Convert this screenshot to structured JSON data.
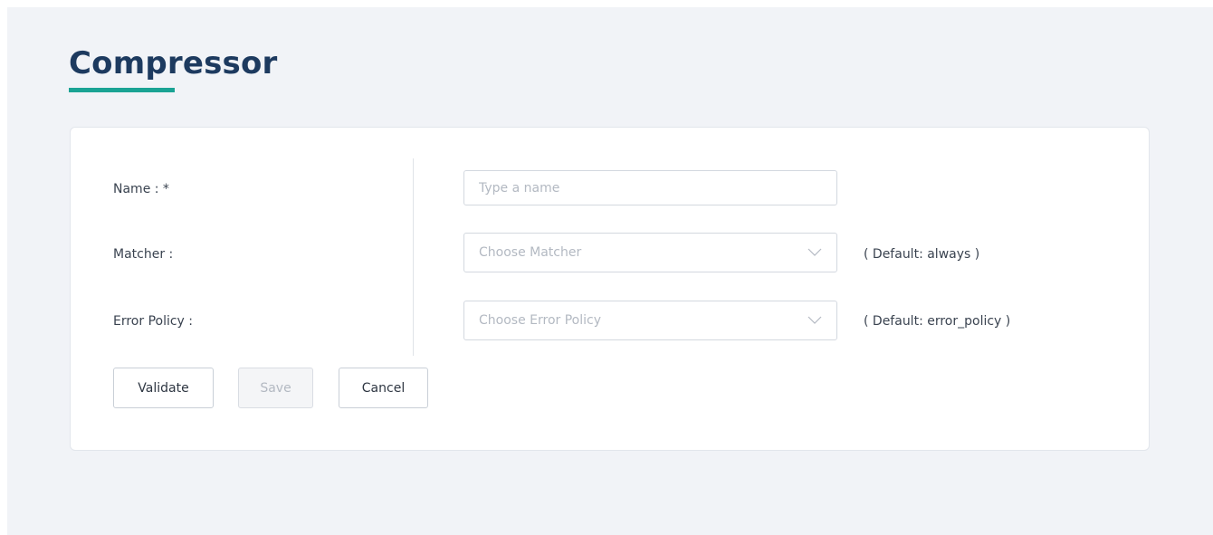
{
  "page": {
    "title": "Compressor"
  },
  "form": {
    "name": {
      "label": "Name : *",
      "placeholder": "Type a name",
      "value": ""
    },
    "matcher": {
      "label": "Matcher :",
      "placeholder": "Choose Matcher",
      "default_note": "( Default: always )",
      "icon": "chevron-down-icon"
    },
    "error_policy": {
      "label": "Error Policy :",
      "placeholder": "Choose Error Policy",
      "default_note": "( Default: error_policy )",
      "icon": "chevron-down-icon"
    }
  },
  "actions": {
    "validate_label": "Validate",
    "save_label": "Save",
    "save_disabled": true,
    "cancel_label": "Cancel"
  },
  "colors": {
    "title": "#1d3a5f",
    "accent_underline": "#1aa394",
    "background": "#f1f3f7",
    "card": "#ffffff"
  }
}
